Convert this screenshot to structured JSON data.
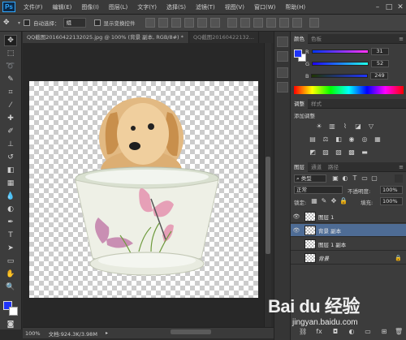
{
  "app": {
    "logo": "Ps"
  },
  "menu": [
    "文件(F)",
    "编辑(E)",
    "图像(I)",
    "图层(L)",
    "文字(Y)",
    "选择(S)",
    "滤镜(T)",
    "视图(V)",
    "窗口(W)",
    "帮助(H)"
  ],
  "window_controls": [
    "–",
    "□",
    "✕"
  ],
  "options_bar": {
    "auto_select_label": "自动选择：",
    "auto_select_value": "组",
    "show_transform_label": "显示变换控件"
  },
  "tabs": [
    {
      "label": "QQ截图20160422132025.jpg @ 100% (背景 副本, RGB/8#) *",
      "close": "×"
    },
    {
      "label": "QQ截图20160422132..."
    }
  ],
  "status": {
    "zoom": "100%",
    "doc_info": "文档:924.3K/3.98M"
  },
  "color_panel": {
    "tabs": [
      "颜色",
      "色板"
    ],
    "channels": [
      {
        "label": "R",
        "value": "31"
      },
      {
        "label": "G",
        "value": "52"
      },
      {
        "label": "B",
        "value": "249"
      }
    ],
    "foreground_color": "#1f34f9",
    "background_color": "#ffffff"
  },
  "adjust_panel": {
    "tabs": [
      "调整",
      "样式"
    ],
    "title": "添加调整"
  },
  "layers_panel": {
    "tabs": [
      "图层",
      "通道",
      "路径"
    ],
    "filter_label": "类型",
    "blend_mode": "正常",
    "opacity_label": "不透明度:",
    "opacity_value": "100%",
    "lock_label": "锁定:",
    "fill_label": "填充:",
    "fill_value": "100%",
    "layers": [
      {
        "name": "图层 1",
        "visible": true,
        "selected": false
      },
      {
        "name": "背景 副本",
        "visible": true,
        "selected": true
      },
      {
        "name": "图层 1 副本",
        "visible": false,
        "selected": false
      },
      {
        "name": "背景",
        "visible": false,
        "selected": false,
        "locked": true
      }
    ]
  },
  "watermark": {
    "brand": "Bai du 经验",
    "url": "jingyan.baidu.com"
  }
}
